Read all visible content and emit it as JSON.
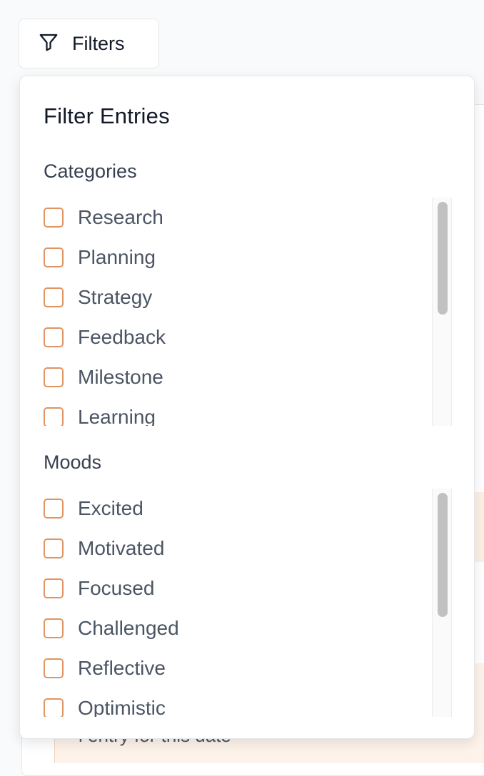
{
  "toolbar": {
    "filters_label": "Filters",
    "filter_icon": "filter-funnel-icon"
  },
  "background": {
    "partial_text": "l entry for this date"
  },
  "popover": {
    "title": "Filter Entries",
    "categories": {
      "title": "Categories",
      "items": [
        {
          "label": "Research",
          "checked": false
        },
        {
          "label": "Planning",
          "checked": false
        },
        {
          "label": "Strategy",
          "checked": false
        },
        {
          "label": "Feedback",
          "checked": false
        },
        {
          "label": "Milestone",
          "checked": false
        },
        {
          "label": "Learning",
          "checked": false
        }
      ]
    },
    "moods": {
      "title": "Moods",
      "items": [
        {
          "label": "Excited",
          "checked": false
        },
        {
          "label": "Motivated",
          "checked": false
        },
        {
          "label": "Focused",
          "checked": false
        },
        {
          "label": "Challenged",
          "checked": false
        },
        {
          "label": "Reflective",
          "checked": false
        },
        {
          "label": "Optimistic",
          "checked": false
        }
      ]
    }
  },
  "colors": {
    "checkbox_border": "#e09462",
    "accent_bg": "#fdf0e4"
  }
}
